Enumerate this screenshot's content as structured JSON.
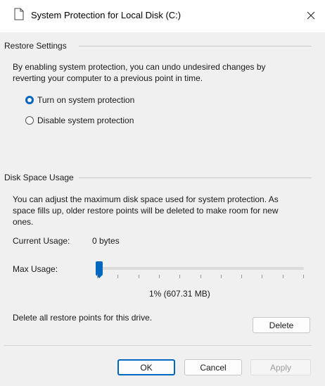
{
  "window": {
    "title": "System Protection for Local Disk  (C:)",
    "icon": "document-icon",
    "close_icon": "close-icon"
  },
  "restore_settings": {
    "group_label": "Restore Settings",
    "description_line1": "By enabling system protection, you can undo undesired changes by",
    "description_line2": "reverting your computer to a previous point in time.",
    "options": [
      {
        "label": "Turn on system protection",
        "selected": true
      },
      {
        "label": "Disable system protection",
        "selected": false
      }
    ]
  },
  "disk_space": {
    "group_label": "Disk Space Usage",
    "description_line1": "You can adjust the maximum disk space used for system protection. As",
    "description_line2": "space fills up, older restore points will be deleted to make room for new",
    "description_line3": "ones.",
    "current_usage_label": "Current Usage:",
    "current_usage_value": "0 bytes",
    "max_usage_label": "Max Usage:",
    "max_usage_fraction": 0.01,
    "max_usage_value": "1% (607.31 MB)",
    "delete_text": "Delete all restore points for this drive.",
    "delete_button": "Delete"
  },
  "buttons": {
    "ok": "OK",
    "cancel": "Cancel",
    "apply": "Apply"
  },
  "colors": {
    "accent": "#0067c0",
    "background": "#f0f0f0"
  }
}
